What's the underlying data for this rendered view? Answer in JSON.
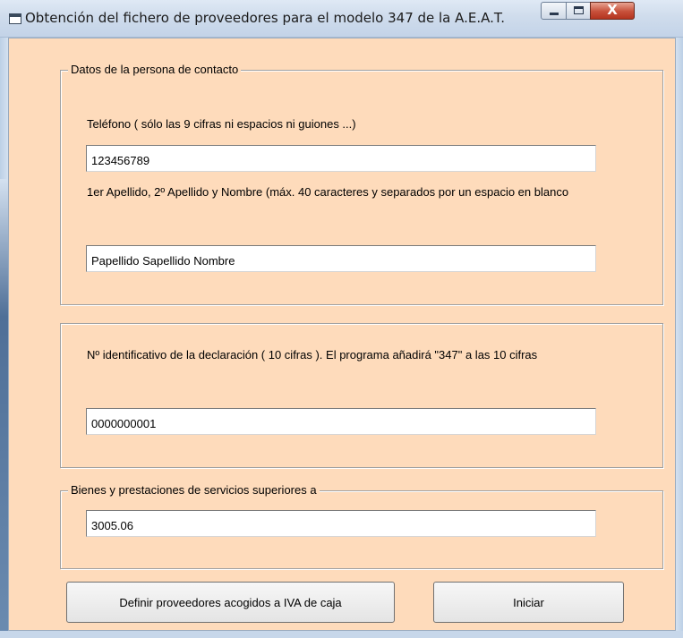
{
  "window": {
    "title": "Obtención del fichero de proveedores para el modelo 347 de la A.E.A.T.",
    "controls": {
      "minimize": "",
      "maximize": "",
      "close": "X"
    }
  },
  "contact_group": {
    "legend": "Datos de la persona de contacto",
    "phone_label": "Teléfono ( sólo las 9 cifras ni espacios ni guiones ...)",
    "phone_value": "123456789",
    "name_label": "1er Apellido, 2º Apellido y Nombre (máx. 40 caracteres y separados por un espacio en blanco",
    "name_value": "Papellido Sapellido Nombre"
  },
  "declaration_group": {
    "label": "Nº identificativo de la declaración ( 10 cifras ). El programa añadirá \"347\" a las 10 cifras",
    "value": "0000000001"
  },
  "threshold_group": {
    "legend": "Bienes y prestaciones de servicios superiores a",
    "value": "3005.06"
  },
  "buttons": {
    "define_suppliers": "Definir proveedores acogidos a IVA de caja",
    "start": "Iniciar"
  },
  "colors": {
    "client_background": "#fedbbb",
    "titlebar": "#cfdcec",
    "close_button": "#c7503a"
  }
}
